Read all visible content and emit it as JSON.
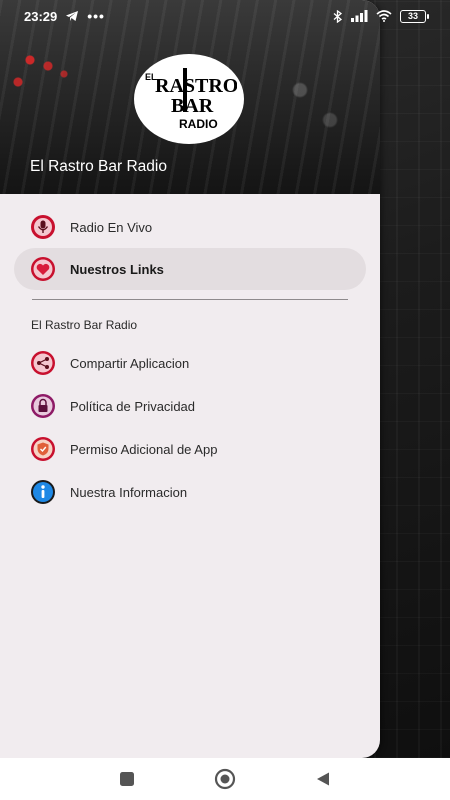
{
  "status_bar": {
    "time": "23:29",
    "notification_icons": [
      "telegram-icon",
      "more-dots-icon"
    ],
    "system_icons": [
      "bluetooth-icon",
      "signal-icon",
      "wifi-icon"
    ],
    "battery_level": "33"
  },
  "drawer": {
    "header": {
      "logo_text": [
        "EL RASTRO",
        "BAR",
        "RADIO"
      ],
      "title": "El Rastro Bar Radio"
    },
    "main_items": [
      {
        "label": "Radio En Vivo",
        "icon": "microphone-icon",
        "active": false
      },
      {
        "label": "Nuestros Links",
        "icon": "heart-icon",
        "active": true
      }
    ],
    "section_label": "El Rastro Bar Radio",
    "secondary_items": [
      {
        "label": "Compartir Aplicacion",
        "icon": "share-icon"
      },
      {
        "label": "Política de Privacidad",
        "icon": "lock-icon"
      },
      {
        "label": "Permiso Adicional de App",
        "icon": "shield-icon"
      },
      {
        "label": "Nuestra Informacion",
        "icon": "info-icon"
      }
    ]
  },
  "colors": {
    "drawer_bg": "#f1ecef",
    "active_item_bg": "#e3dde0",
    "icon_red": "#c8102e",
    "icon_blue": "#1565c0"
  },
  "nav_bar": [
    "recents-square-icon",
    "home-circle-icon",
    "back-triangle-icon"
  ]
}
